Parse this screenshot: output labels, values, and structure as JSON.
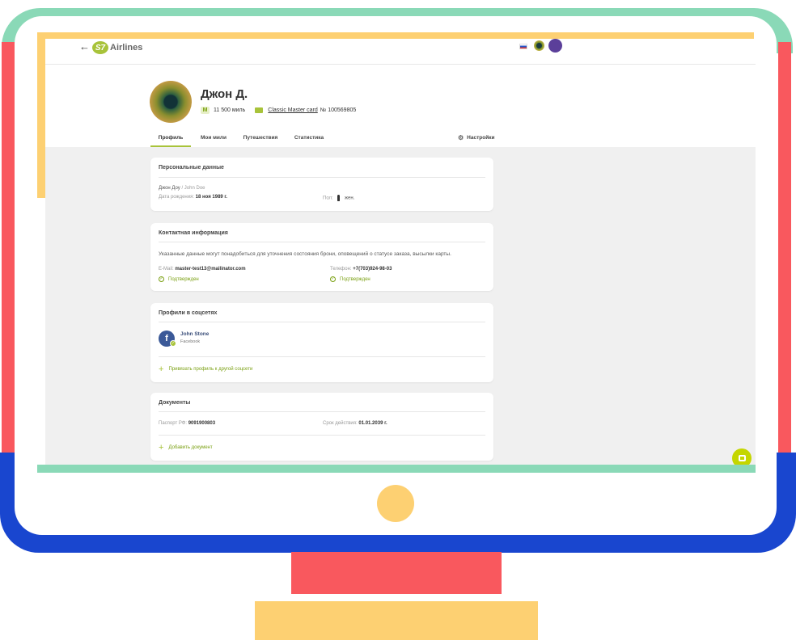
{
  "header": {
    "back_symbol": "←",
    "logo_badge": "S7",
    "logo_text": "Airlines"
  },
  "profile": {
    "name": "Джон Д.",
    "miles_badge": "M",
    "miles": "11 500 миль",
    "card_name": "Classic Master card",
    "card_number": "№ 100569805"
  },
  "tabs": [
    {
      "label": "Профиль"
    },
    {
      "label": "Мои мили"
    },
    {
      "label": "Путешествия"
    },
    {
      "label": "Статистика"
    }
  ],
  "settings_label": "Настройки",
  "personal": {
    "title": "Персональные данные",
    "name": "Джон Доу",
    "name_latin": "/ John Doe",
    "dob_label": "Дата рождения:",
    "dob_value": "18 ноя 1989 г.",
    "gender_label": "Пол:",
    "gender_value": "жен."
  },
  "contact": {
    "title": "Контактная информация",
    "note": "Указанные данные могут понадобиться для уточнения состояния брони, оповещений о статусе заказа, высылки карты.",
    "email_label": "E-Mail:",
    "email_value": "master-test13@mailinator.com",
    "phone_label": "Телефон:",
    "phone_value": "+7(703)924-98-03",
    "verified_label": "Подтвержден"
  },
  "social": {
    "title": "Профили в соцсетях",
    "account_name": "John Stone",
    "network": "Facebook",
    "fb_letter": "f",
    "link_label": "Привязать профиль к другой соцсети"
  },
  "documents": {
    "title": "Документы",
    "passport_label": "Паспорт РФ:",
    "passport_value": "9091900803",
    "expiry_label": "Срок действия:",
    "expiry_value": "01.01.2039 г.",
    "add_label": "Добавить документ"
  },
  "colors": {
    "accent": "#a8c33a",
    "frame_green": "#8ad9b7",
    "frame_red": "#f9585e",
    "frame_blue": "#1946cf",
    "frame_yellow": "#fdd072"
  }
}
